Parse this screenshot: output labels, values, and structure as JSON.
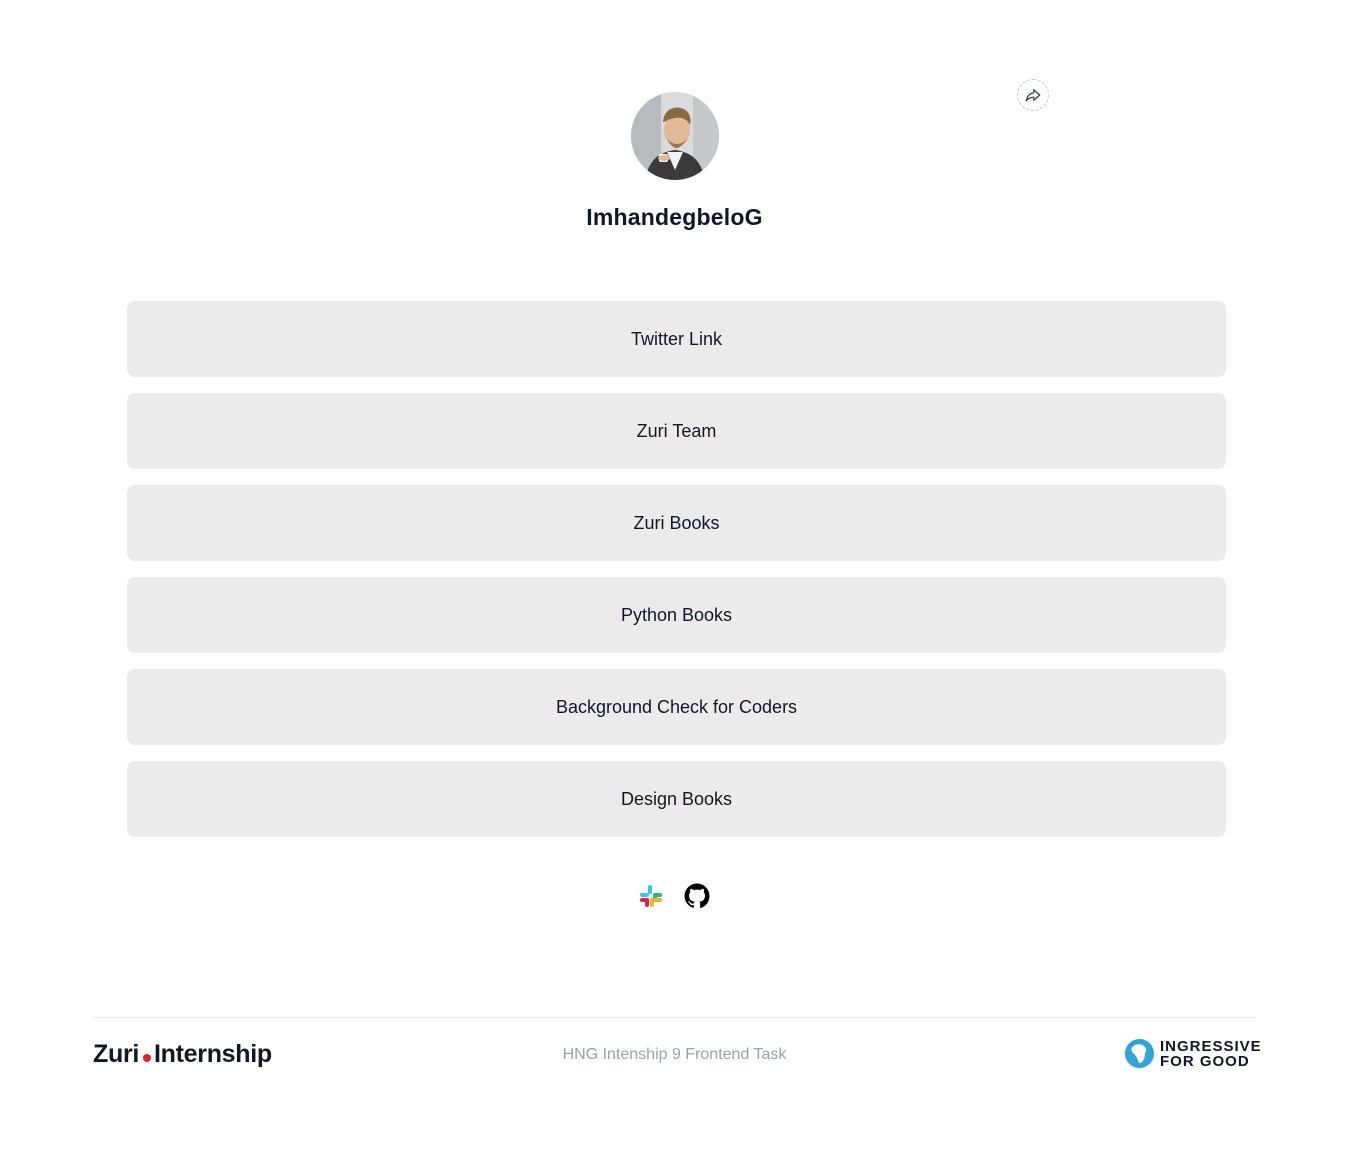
{
  "profile": {
    "username": "ImhandegbeloG",
    "avatar_alt": "profile-photo"
  },
  "share": {
    "icon": "share-icon"
  },
  "links": [
    {
      "label": "Twitter Link"
    },
    {
      "label": "Zuri Team"
    },
    {
      "label": "Zuri Books"
    },
    {
      "label": "Python Books"
    },
    {
      "label": "Background Check for Coders"
    },
    {
      "label": "Design Books"
    }
  ],
  "socials": [
    {
      "icon": "slack-icon"
    },
    {
      "icon": "github-icon"
    }
  ],
  "footer": {
    "brand_left_1": "Zuri",
    "brand_left_2": "Internship",
    "task": "HNG Intenship 9 Frontend Task",
    "brand_right_1": "INGRESSIVE",
    "brand_right_2": "FOR GOOD"
  },
  "colors": {
    "button_bg": "#eceaed",
    "text": "#101828",
    "muted": "#98a2b3",
    "zuri_dot": "#e2202a"
  }
}
